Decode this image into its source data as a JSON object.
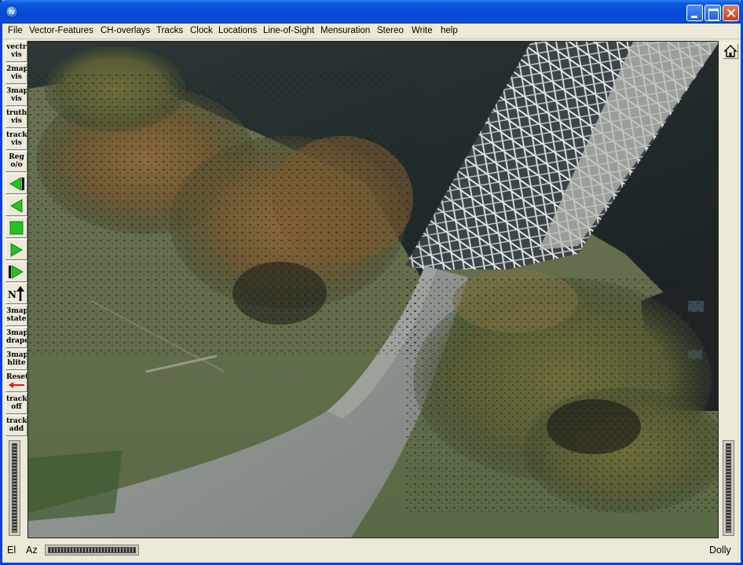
{
  "titlebar": {
    "app_icon_name": "iv-app-icon",
    "app_icon_letter": "IV"
  },
  "menu": {
    "items": [
      "File",
      "Vector-Features",
      "CH-overlays",
      "Tracks",
      "Clock",
      "Locations",
      "Line-of-Sight",
      "Mensuration",
      "Stereo",
      "Write",
      "help"
    ]
  },
  "toolbar": {
    "buttons": [
      {
        "label": "vectr\nvis",
        "kind": "text"
      },
      {
        "label": "2map\nvis",
        "kind": "text"
      },
      {
        "label": "3map\nvis",
        "kind": "text"
      },
      {
        "label": "truth\nvis",
        "kind": "text"
      },
      {
        "label": "track\nvis",
        "kind": "text"
      },
      {
        "label": "Reg\no/o",
        "kind": "text"
      },
      {
        "label": "",
        "kind": "icon",
        "icon": "skip-back-icon"
      },
      {
        "label": "",
        "kind": "icon",
        "icon": "step-back-icon"
      },
      {
        "label": "",
        "kind": "icon",
        "icon": "stop-icon"
      },
      {
        "label": "",
        "kind": "icon",
        "icon": "play-icon"
      },
      {
        "label": "",
        "kind": "icon",
        "icon": "skip-forward-icon"
      },
      {
        "label": "N",
        "kind": "icon",
        "icon": "north-arrow-icon"
      },
      {
        "label": "3map\nstate",
        "kind": "text"
      },
      {
        "label": "3map\ndrape",
        "kind": "text"
      },
      {
        "label": "3map\nhlite",
        "kind": "text"
      },
      {
        "label": "Reset",
        "kind": "icon",
        "icon": "reset-arrow-icon"
      },
      {
        "label": "track\noff",
        "kind": "text"
      },
      {
        "label": "track\nadd",
        "kind": "text"
      }
    ]
  },
  "bottom": {
    "el_label": "El",
    "az_label": "Az",
    "dolly_label": "Dolly"
  },
  "colors": {
    "titlebar_blue": "#0648d6",
    "play_green": "#22c322",
    "reset_red": "#d42020"
  }
}
